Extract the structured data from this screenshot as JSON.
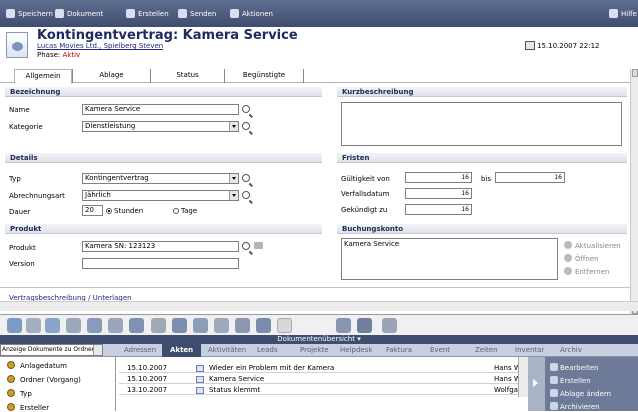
{
  "toolbar": {
    "items": [
      "Speichern",
      "Dokument",
      "Erstellen",
      "Senden",
      "Aktionen"
    ],
    "help": "Hilfe"
  },
  "header": {
    "title": "Kontingentvertrag: Kamera Service",
    "company": "Lucas Movies Ltd., Spielberg Steven",
    "phase_label": "Phase:",
    "phase_value": "Aktiv",
    "datetime": "15.10.2007 22:12"
  },
  "tabs": [
    "Allgemein",
    "Ablage",
    "Status",
    "Begünstigte"
  ],
  "sections": {
    "bezeichnung": {
      "title": "Bezeichnung",
      "name_label": "Name",
      "name_value": "Kamera Service",
      "kategorie_label": "Kategorie",
      "kategorie_value": "Dienstleistung"
    },
    "kurzbeschreibung": {
      "title": "Kurzbeschreibung",
      "value": ""
    },
    "details": {
      "title": "Details",
      "typ_label": "Typ",
      "typ_value": "Kontingentvertrag",
      "abr_label": "Abrechnungsart",
      "abr_value": "Jährlich",
      "dauer_label": "Dauer",
      "dauer_value": "20",
      "unit_1": "Stunden",
      "unit_2": "Tage"
    },
    "fristen": {
      "title": "Fristen",
      "gueltig_label": "Gültigkeit von",
      "bis_label": "bis",
      "verfall_label": "Verfallsdatum",
      "gekuendigt_label": "Gekündigt zu",
      "date_icon_text": "16"
    },
    "produkt": {
      "title": "Produkt",
      "produkt_label": "Produkt",
      "produkt_value": "Kamera SN: 123123",
      "version_label": "Version",
      "version_value": ""
    },
    "buchungskonto": {
      "title": "Buchungskonto",
      "value": "Kamera Service",
      "actions": [
        "Aktualisieren",
        "Öffnen",
        "Entfernen"
      ]
    }
  },
  "bottom": {
    "vertrags_label": "Vertragsbeschreibung / Unterlagen",
    "overview": "Dokumentenübersicht"
  },
  "nav": {
    "filter": "Anzeige Dokumente zu Ordner",
    "tabs": [
      "Adressen",
      "Akten",
      "Aktivitäten",
      "Leads",
      "Projekte",
      "Helpdesk",
      "Faktura",
      "Event",
      "Zeiten",
      "Inventar",
      "Archiv"
    ]
  },
  "folders": [
    "Anlagedatum",
    "Ordner (Vorgang)",
    "Typ",
    "Ersteller"
  ],
  "docs": [
    {
      "date": "15.10.2007",
      "title": "Wieder ein Problem mit der Kamera",
      "user": "Hans W"
    },
    {
      "date": "15.10.2007",
      "title": "Kamera Service",
      "user": "Hans W"
    },
    {
      "date": "13.10.2007",
      "title": "Status klemmt",
      "user": "Wolfgan"
    }
  ],
  "doc_actions": [
    "Bearbeiten",
    "Erstellen",
    "Ablage ändern",
    "Archivieren"
  ]
}
